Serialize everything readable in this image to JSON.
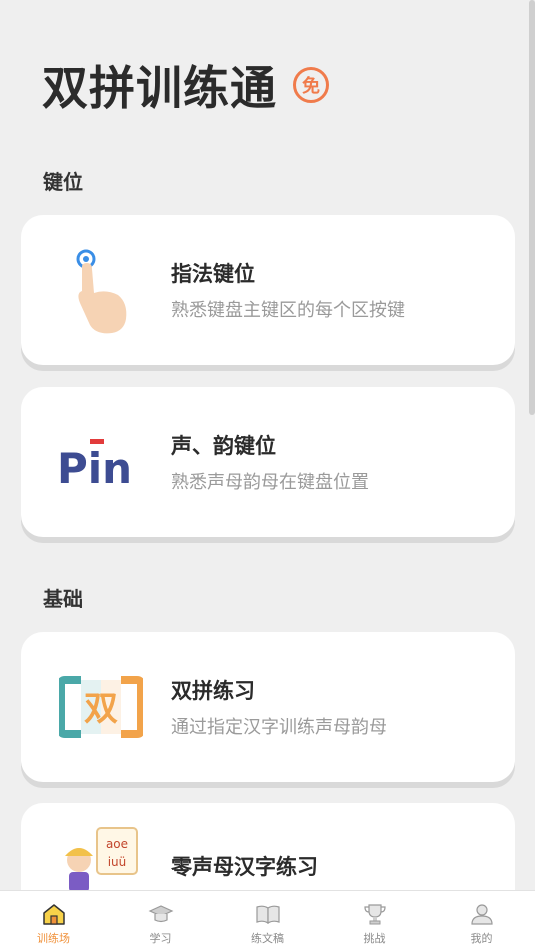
{
  "header": {
    "title": "双拼训练通",
    "badge": "免"
  },
  "sections": [
    {
      "title": "键位",
      "cards": [
        {
          "title": "指法键位",
          "desc": "熟悉键盘主键区的每个区按键",
          "icon": "finger-tap-icon"
        },
        {
          "title": "声、韵键位",
          "desc": "熟悉声母韵母在键盘位置",
          "icon": "pin-logo-icon",
          "icon_text": "Pin"
        }
      ]
    },
    {
      "title": "基础",
      "cards": [
        {
          "title": "双拼练习",
          "desc": "通过指定汉字训练声母韵母",
          "icon": "shuang-icon",
          "icon_text": "双"
        },
        {
          "title": "零声母汉字练习",
          "desc": "",
          "icon": "child-board-icon",
          "icon_text_lines": [
            "aoe",
            "iuü"
          ]
        }
      ]
    }
  ],
  "bottom_nav": [
    {
      "label": "训练场",
      "icon": "home-icon",
      "active": true
    },
    {
      "label": "学习",
      "icon": "graduation-cap-icon",
      "active": false
    },
    {
      "label": "练文稿",
      "icon": "book-icon",
      "active": false
    },
    {
      "label": "挑战",
      "icon": "trophy-icon",
      "active": false
    },
    {
      "label": "我的",
      "icon": "user-icon",
      "active": false
    }
  ],
  "colors": {
    "accent": "#f07b4b",
    "nav_active": "#f0913a",
    "pin_blue": "#3d4c92",
    "pin_red": "#e23b3b",
    "teal": "#4aa8a8",
    "orange": "#f2a34a"
  }
}
